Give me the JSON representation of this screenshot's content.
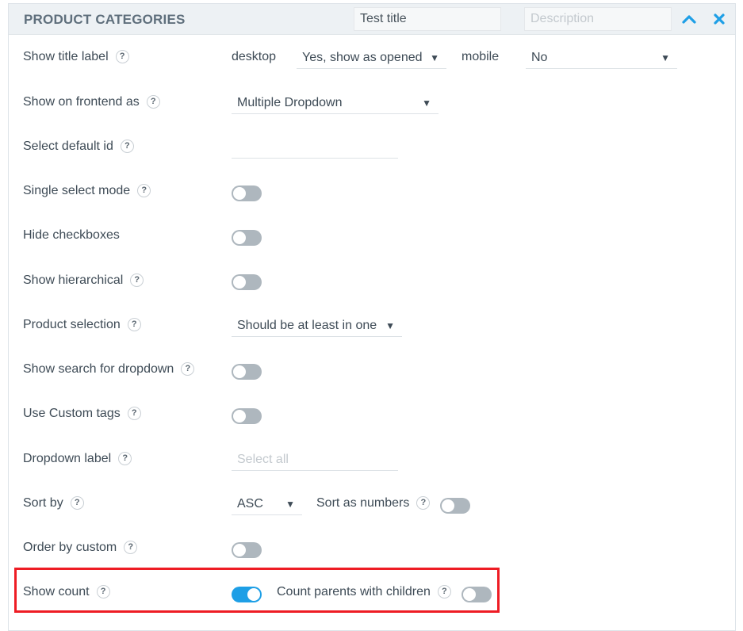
{
  "header": {
    "title": "PRODUCT CATEGORIES",
    "title_value": "Test title",
    "description_placeholder": "Description",
    "collapse_icon": "chevron-up-icon",
    "close_icon": "close-icon",
    "accent_color": "#1e9fe6"
  },
  "help_glyph": "?",
  "rows": {
    "show_title_label": {
      "label": "Show title label",
      "desktop_label": "desktop",
      "desktop_value": "Yes, show as opened",
      "mobile_label": "mobile",
      "mobile_value": "No"
    },
    "show_on_frontend": {
      "label": "Show on frontend as",
      "value": "Multiple Dropdown"
    },
    "select_default_id": {
      "label": "Select default id",
      "value": ""
    },
    "single_select_mode": {
      "label": "Single select mode",
      "enabled": false
    },
    "hide_checkboxes": {
      "label": "Hide checkboxes",
      "enabled": false
    },
    "show_hierarchical": {
      "label": "Show hierarchical",
      "enabled": false
    },
    "product_selection": {
      "label": "Product selection",
      "value": "Should be at least in one"
    },
    "show_search": {
      "label": "Show search for dropdown",
      "enabled": false
    },
    "use_custom_tags": {
      "label": "Use Custom tags",
      "enabled": false
    },
    "dropdown_label": {
      "label": "Dropdown label",
      "placeholder": "Select all"
    },
    "sort_by": {
      "label": "Sort by",
      "value": "ASC",
      "numbers_label": "Sort as numbers",
      "numbers_enabled": false
    },
    "order_by_custom": {
      "label": "Order by custom",
      "enabled": false
    },
    "show_count": {
      "label": "Show count",
      "enabled": true,
      "parents_label": "Count parents with children",
      "parents_enabled": false
    }
  },
  "arrow_glyph": "▼",
  "highlight_color": "#ee1c24"
}
